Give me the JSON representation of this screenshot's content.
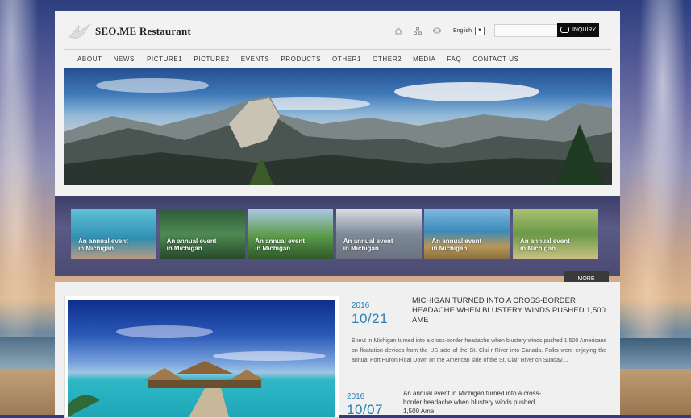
{
  "brand": {
    "name": "SEO.ME Restaurant"
  },
  "header": {
    "language": "English",
    "search_placeholder": "",
    "inquiry_label": "INQUIRY"
  },
  "nav": {
    "items": [
      "ABOUT",
      "NEWS",
      "PICTURE1",
      "PICTURE2",
      "EVENTS",
      "PRODUCTS",
      "OTHER1",
      "OTHER2",
      "MEDIA",
      "FAQ",
      "CONTACT US"
    ]
  },
  "gallery": {
    "items": [
      {
        "caption_line1": "An annual event",
        "caption_line2": "in Michigan"
      },
      {
        "caption_line1": "An annual event",
        "caption_line2": "in Michigan"
      },
      {
        "caption_line1": "An annual event",
        "caption_line2": "in Michigan"
      },
      {
        "caption_line1": "An annual event",
        "caption_line2": "in Michigan"
      },
      {
        "caption_line1": "An annual event",
        "caption_line2": "in Michigan"
      },
      {
        "caption_line1": "An annual event",
        "caption_line2": "in Michigan"
      }
    ],
    "more_label": "MORE"
  },
  "news": [
    {
      "year": "2016",
      "date": "10/21",
      "title": "MICHIGAN TURNED INTO A CROSS-BORDER HEADACHE WHEN BLUSTERY WINDS PUSHED 1,500 AME",
      "summary": "Enevt in Michigan turned into a cross-border headache when blustery winds pushed 1,500 Americans on floatation devices from the US side of the St. Clai r River into Canada. Folks were enjoying the annual Port Huron Float Down on the American side of the St. Clair River on Sunday,..."
    },
    {
      "year": "2016",
      "date": "10/07",
      "title": "An annual event in Michigan turned into a cross-border headache when blustery winds pushed 1,500 Ame"
    }
  ],
  "colors": {
    "accent": "#2d7fb2",
    "inquiry_bg": "#0c0c0c",
    "band_bg": "#4a4a72"
  }
}
